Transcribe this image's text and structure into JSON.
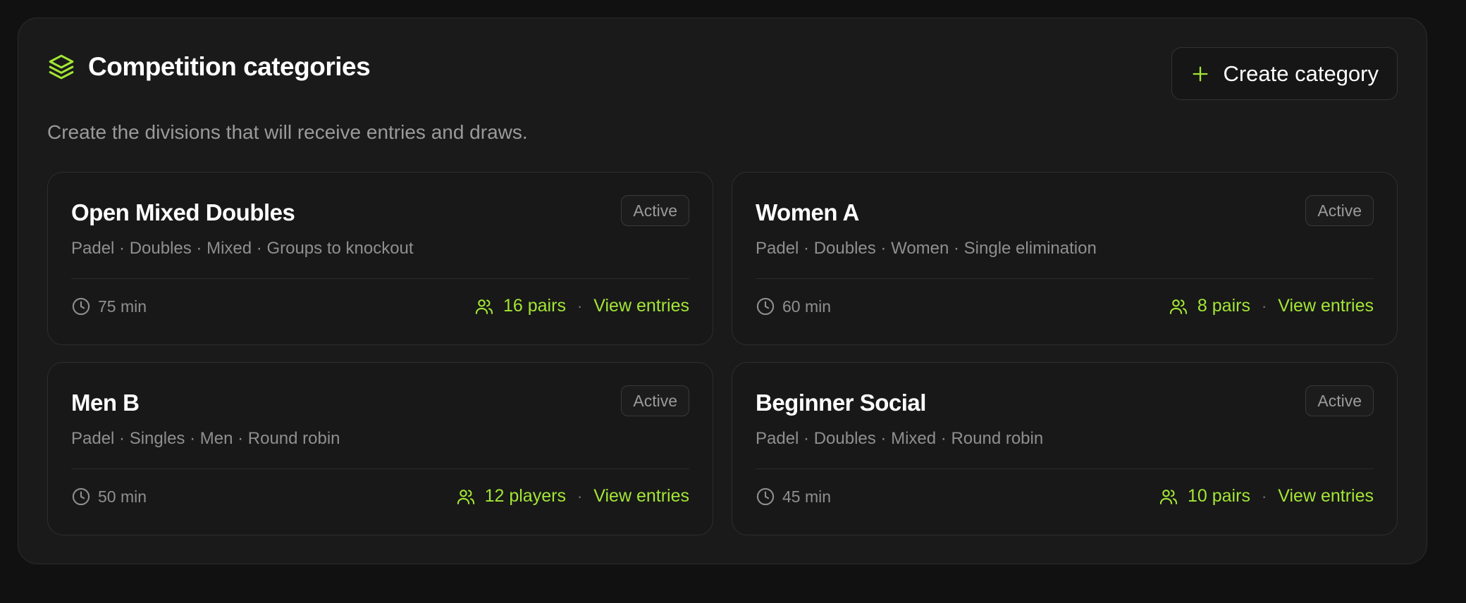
{
  "header": {
    "title": "Competition categories",
    "subtitle": "Create the divisions that will receive entries and draws.",
    "create_button_label": "Create category"
  },
  "colors": {
    "accent": "#a3e635",
    "background": "#111111",
    "panel": "#1a1a1a",
    "muted_text": "#9a9a9a"
  },
  "categories": [
    {
      "name": "Open Mixed Doubles",
      "status": "Active",
      "meta": "Padel · Doubles · Mixed · Groups to knockout",
      "duration": "75 min",
      "count": "16 pairs",
      "separator": "·",
      "link": "View entries"
    },
    {
      "name": "Women A",
      "status": "Active",
      "meta": "Padel · Doubles · Women · Single elimination",
      "duration": "60 min",
      "count": "8 pairs",
      "separator": "·",
      "link": "View entries"
    },
    {
      "name": "Men B",
      "status": "Active",
      "meta": "Padel · Singles · Men · Round robin",
      "duration": "50 min",
      "count": "12 players",
      "separator": "·",
      "link": "View entries"
    },
    {
      "name": "Beginner Social",
      "status": "Active",
      "meta": "Padel · Doubles · Mixed · Round robin",
      "duration": "45 min",
      "count": "10 pairs",
      "separator": "·",
      "link": "View entries"
    }
  ],
  "icons": {
    "header": "layers-icon",
    "create": "plus-icon",
    "duration": "clock-icon",
    "count": "users-icon"
  }
}
